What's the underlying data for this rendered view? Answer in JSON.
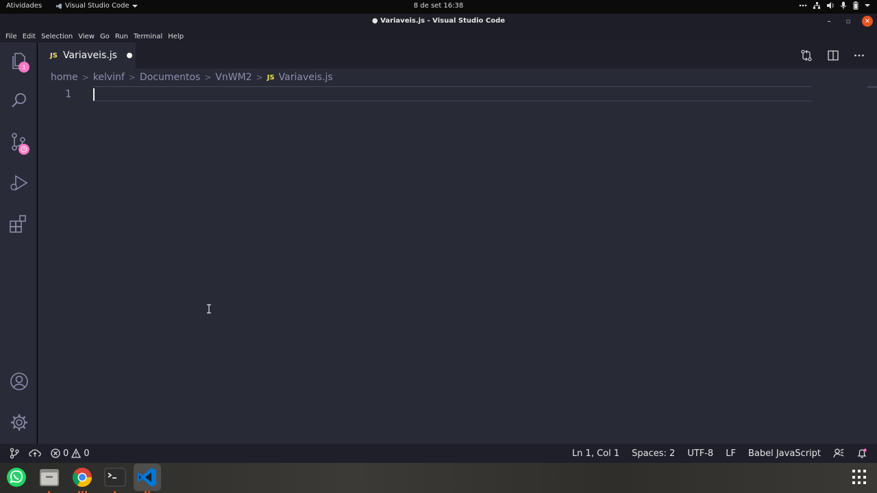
{
  "topbar": {
    "activities": "Atividades",
    "app_name": "Visual Studio Code",
    "clock": "8 de set  16:38"
  },
  "window": {
    "title": "● Variaveis.js - Visual Studio Code"
  },
  "menu": [
    "File",
    "Edit",
    "Selection",
    "View",
    "Go",
    "Run",
    "Terminal",
    "Help"
  ],
  "activitybar": {
    "explorer_badge": "1"
  },
  "tab": {
    "lang": "JS",
    "name": "Variaveis.js"
  },
  "breadcrumb": {
    "parts": [
      "home",
      "kelvinf",
      "Documentos",
      "VnWM2"
    ],
    "file_lang": "JS",
    "file": "Variaveis.js"
  },
  "editor": {
    "line_number": "1"
  },
  "status": {
    "errors": "0",
    "warnings": "0",
    "position": "Ln 1, Col 1",
    "spaces": "Spaces: 2",
    "encoding": "UTF-8",
    "eol": "LF",
    "language": "Babel JavaScript"
  },
  "colors": {
    "editor_bg": "#282a36",
    "activity_bg": "#2a2b39",
    "badge": "#ff79c6",
    "js_yellow": "#f1e05a",
    "ubuntu_orange": "#e95420"
  }
}
